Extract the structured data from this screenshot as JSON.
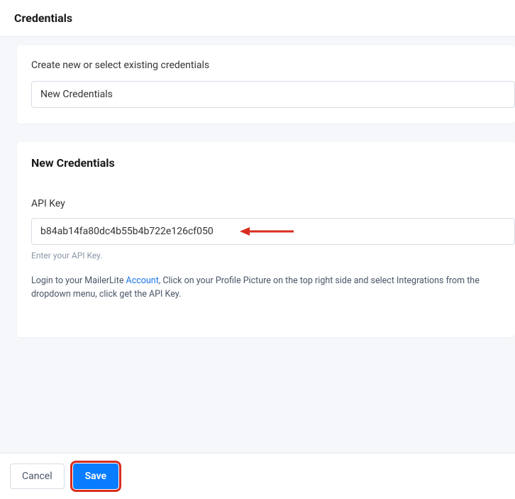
{
  "header": {
    "title": "Credentials"
  },
  "selectCard": {
    "label": "Create new or select existing credentials",
    "value": "New Credentials"
  },
  "form": {
    "title": "New Credentials",
    "apiKey": {
      "label": "API Key",
      "value": "b84ab14fa80dc4b55b4b722e126cf050",
      "hint": "Enter your API Key."
    },
    "help": {
      "prefix": "Login to your MailerLite ",
      "link": "Account",
      "suffix": ", Click on your Profile Picture on the top right side and select Integrations from the dropdown menu, click get the API Key."
    }
  },
  "footer": {
    "cancel": "Cancel",
    "save": "Save"
  },
  "annotation": {
    "arrowColor": "#d92d20"
  }
}
